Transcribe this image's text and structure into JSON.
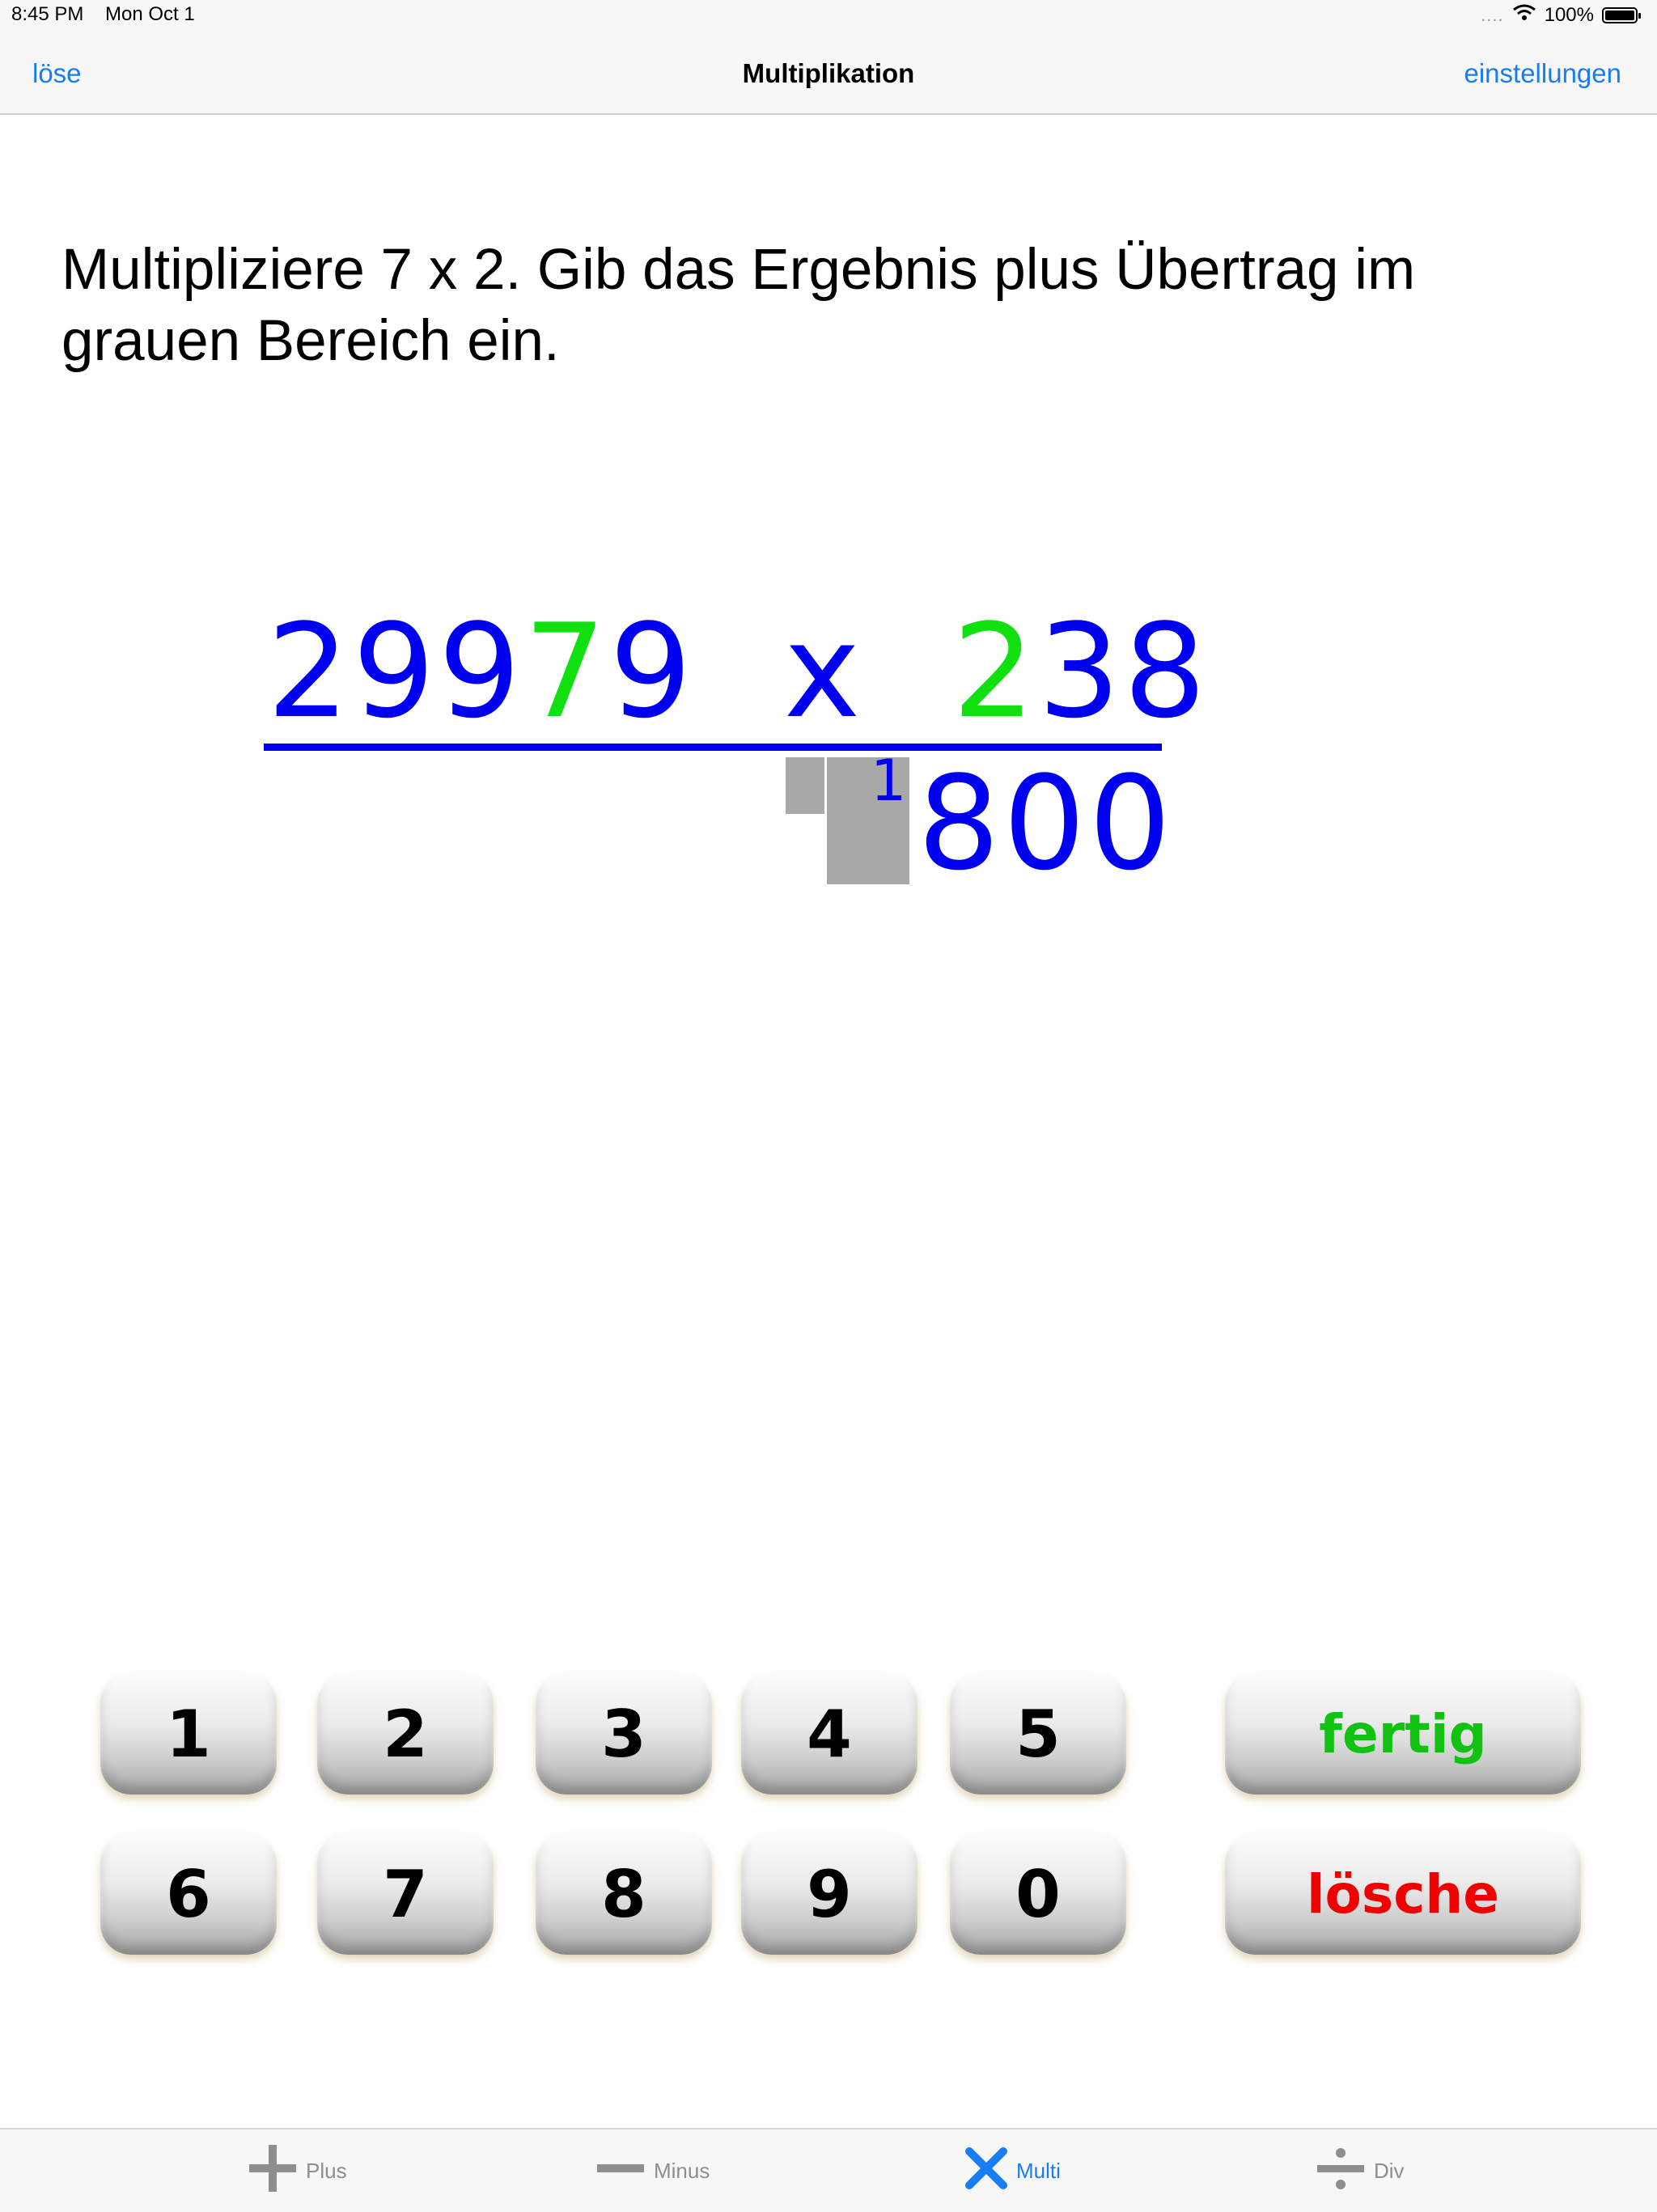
{
  "status_bar": {
    "time": "8:45 PM",
    "date": "Mon Oct 1",
    "signal_dots": "....",
    "battery": "100%"
  },
  "nav": {
    "left_label": "löse",
    "title": "Multiplikation",
    "right_label": "einstellungen"
  },
  "instruction": "Multipliziere 7 x 2.  Gib das Ergebnis plus Übertrag im grauen Bereich ein.",
  "problem": {
    "multiplicand_a": "299",
    "multiplicand_highlight": "7",
    "multiplicand_b": "9",
    "operator": "x",
    "multiplier_highlight": "2",
    "multiplier_rest": "38",
    "carry": "1",
    "partial_result": "800",
    "colors": {
      "digits": "#0000f0",
      "highlight": "#10e010",
      "input_area": "#a8a8a8"
    }
  },
  "keypad": {
    "row1": [
      "1",
      "2",
      "3",
      "4",
      "5"
    ],
    "row2": [
      "6",
      "7",
      "8",
      "9",
      "0"
    ],
    "done_label": "fertig",
    "clear_label": "lösche",
    "colors": {
      "done": "#12c212",
      "clear": "#f00000"
    }
  },
  "tabs": [
    {
      "label": "Plus",
      "icon": "plus-icon"
    },
    {
      "label": "Minus",
      "icon": "minus-icon"
    },
    {
      "label": "Multi",
      "icon": "multiply-icon",
      "active": true
    },
    {
      "label": "Div",
      "icon": "divide-icon"
    }
  ]
}
